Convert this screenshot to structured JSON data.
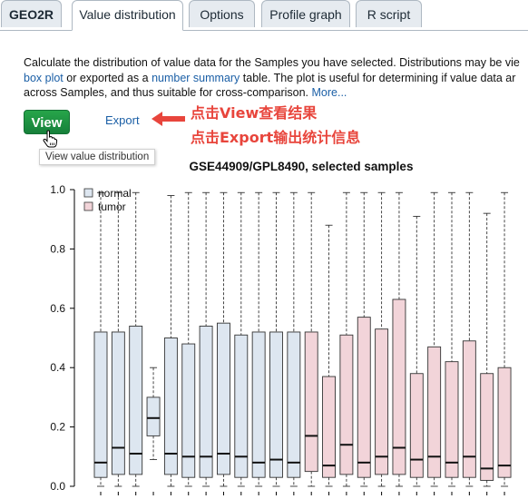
{
  "tabs": [
    {
      "label": "GEO2R",
      "active": false
    },
    {
      "label": "Value distribution",
      "active": true
    },
    {
      "label": "Options",
      "active": false
    },
    {
      "label": "Profile graph",
      "active": false
    },
    {
      "label": "R script",
      "active": false
    }
  ],
  "description": {
    "line1": "Calculate the distribution of value data for the Samples you have selected. Distributions may be vie",
    "line2_link1": "box plot",
    "line2_mid": " or exported as a ",
    "line2_link2": "number summary",
    "line2_end": " table. The plot is useful for determining if value data ar",
    "line3": "across Samples, and thus suitable for cross-comparison. ",
    "line3_more": "More..."
  },
  "actions": {
    "view_label": "View",
    "export_label": "Export",
    "tooltip": "View value distribution"
  },
  "annotations": {
    "line1": "点击View查看结果",
    "line2": "点击Export输出统计信息"
  },
  "colors": {
    "accent_green": "#1e9440",
    "link": "#1b5fa6",
    "annotation_red": "#e8453c",
    "normal_fill": "#dde6f0",
    "tumor_fill": "#f2d4d9"
  },
  "chart_data": {
    "type": "boxplot",
    "title": "GSE44909/GPL8490, selected samples",
    "ylim": [
      0,
      1.0
    ],
    "yticks": [
      "0.0",
      "0.2",
      "0.4",
      "0.6",
      "0.8",
      "1.0"
    ],
    "legend": {
      "position": "top-left",
      "entries": [
        "normal",
        "tumor"
      ]
    },
    "boxes": [
      {
        "group": "normal",
        "min": 0.0,
        "q1": 0.03,
        "median": 0.08,
        "q3": 0.52,
        "max": 0.99
      },
      {
        "group": "normal",
        "min": 0.0,
        "q1": 0.04,
        "median": 0.13,
        "q3": 0.52,
        "max": 0.99
      },
      {
        "group": "normal",
        "min": 0.0,
        "q1": 0.04,
        "median": 0.11,
        "q3": 0.54,
        "max": 0.99
      },
      {
        "group": "normal",
        "min": 0.09,
        "q1": 0.17,
        "median": 0.23,
        "q3": 0.3,
        "max": 0.4
      },
      {
        "group": "normal",
        "min": 0.0,
        "q1": 0.04,
        "median": 0.11,
        "q3": 0.5,
        "max": 0.98
      },
      {
        "group": "normal",
        "min": 0.0,
        "q1": 0.03,
        "median": 0.1,
        "q3": 0.48,
        "max": 0.99
      },
      {
        "group": "normal",
        "min": 0.0,
        "q1": 0.03,
        "median": 0.1,
        "q3": 0.54,
        "max": 0.99
      },
      {
        "group": "normal",
        "min": 0.0,
        "q1": 0.04,
        "median": 0.11,
        "q3": 0.55,
        "max": 0.99
      },
      {
        "group": "normal",
        "min": 0.0,
        "q1": 0.03,
        "median": 0.1,
        "q3": 0.51,
        "max": 0.99
      },
      {
        "group": "normal",
        "min": 0.0,
        "q1": 0.03,
        "median": 0.08,
        "q3": 0.52,
        "max": 0.99
      },
      {
        "group": "normal",
        "min": 0.0,
        "q1": 0.03,
        "median": 0.09,
        "q3": 0.52,
        "max": 0.99
      },
      {
        "group": "normal",
        "min": 0.0,
        "q1": 0.03,
        "median": 0.08,
        "q3": 0.52,
        "max": 0.99
      },
      {
        "group": "tumor",
        "min": 0.0,
        "q1": 0.05,
        "median": 0.17,
        "q3": 0.52,
        "max": 0.99
      },
      {
        "group": "tumor",
        "min": 0.0,
        "q1": 0.03,
        "median": 0.07,
        "q3": 0.37,
        "max": 0.88
      },
      {
        "group": "tumor",
        "min": 0.0,
        "q1": 0.04,
        "median": 0.14,
        "q3": 0.51,
        "max": 0.99
      },
      {
        "group": "tumor",
        "min": 0.0,
        "q1": 0.03,
        "median": 0.08,
        "q3": 0.57,
        "max": 0.99
      },
      {
        "group": "tumor",
        "min": 0.0,
        "q1": 0.04,
        "median": 0.1,
        "q3": 0.53,
        "max": 0.99
      },
      {
        "group": "tumor",
        "min": 0.0,
        "q1": 0.04,
        "median": 0.13,
        "q3": 0.63,
        "max": 0.99
      },
      {
        "group": "tumor",
        "min": 0.0,
        "q1": 0.03,
        "median": 0.09,
        "q3": 0.38,
        "max": 0.91
      },
      {
        "group": "tumor",
        "min": 0.0,
        "q1": 0.03,
        "median": 0.1,
        "q3": 0.47,
        "max": 0.99
      },
      {
        "group": "tumor",
        "min": 0.0,
        "q1": 0.03,
        "median": 0.08,
        "q3": 0.42,
        "max": 0.99
      },
      {
        "group": "tumor",
        "min": 0.0,
        "q1": 0.03,
        "median": 0.1,
        "q3": 0.49,
        "max": 0.99
      },
      {
        "group": "tumor",
        "min": 0.0,
        "q1": 0.02,
        "median": 0.06,
        "q3": 0.38,
        "max": 0.92
      },
      {
        "group": "tumor",
        "min": 0.0,
        "q1": 0.03,
        "median": 0.07,
        "q3": 0.4,
        "max": 0.99
      }
    ]
  }
}
